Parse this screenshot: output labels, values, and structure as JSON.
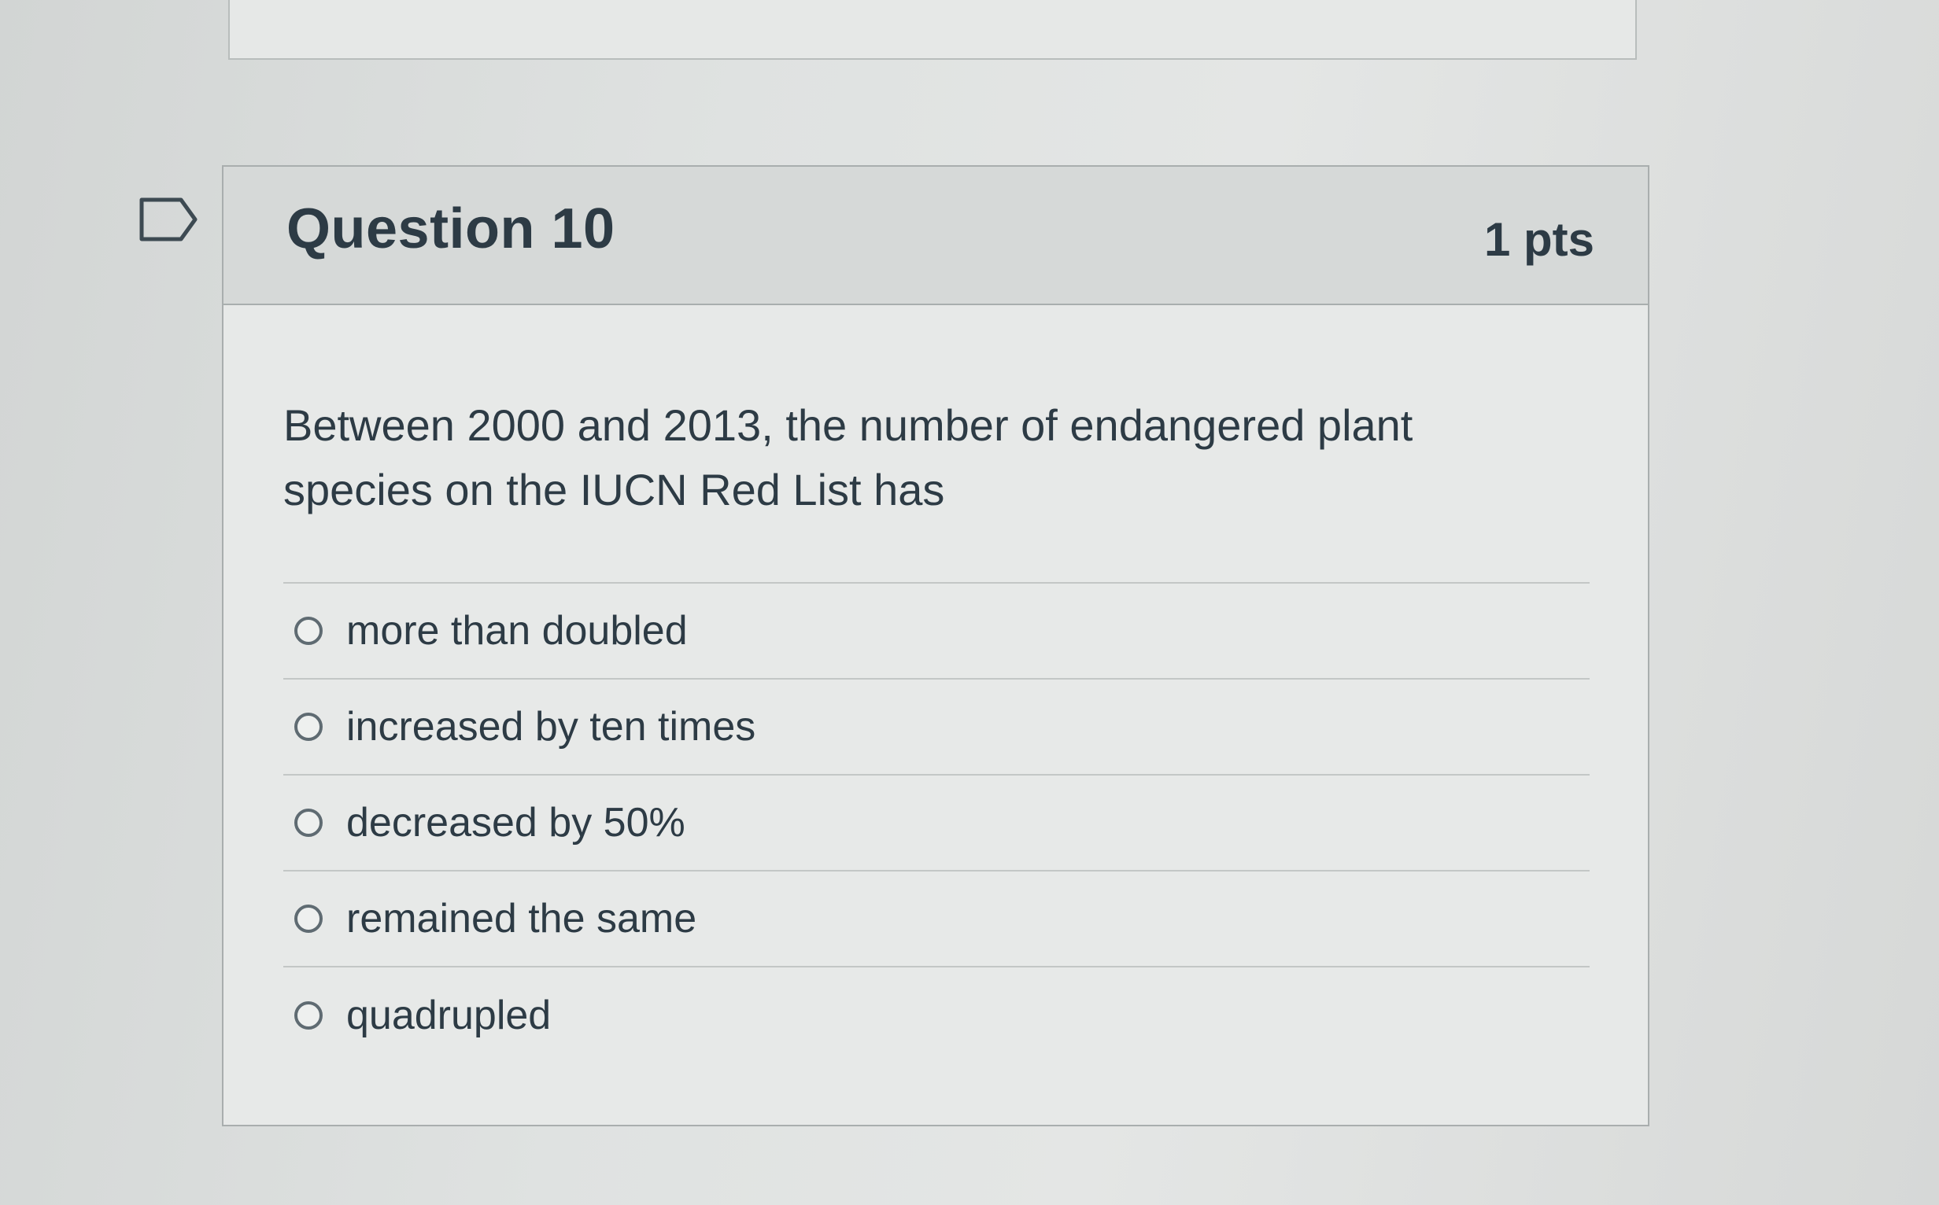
{
  "question": {
    "title": "Question 10",
    "points": "1 pts",
    "text": "Between 2000 and 2013, the number of endangered plant species on the IUCN Red List has",
    "answers": [
      {
        "label": "more than doubled"
      },
      {
        "label": "increased by ten times"
      },
      {
        "label": "decreased by 50%"
      },
      {
        "label": "remained the same"
      },
      {
        "label": "quadrupled"
      }
    ]
  },
  "icons": {
    "flag": "flag-question-icon",
    "radio": "radio-unselected-icon"
  }
}
